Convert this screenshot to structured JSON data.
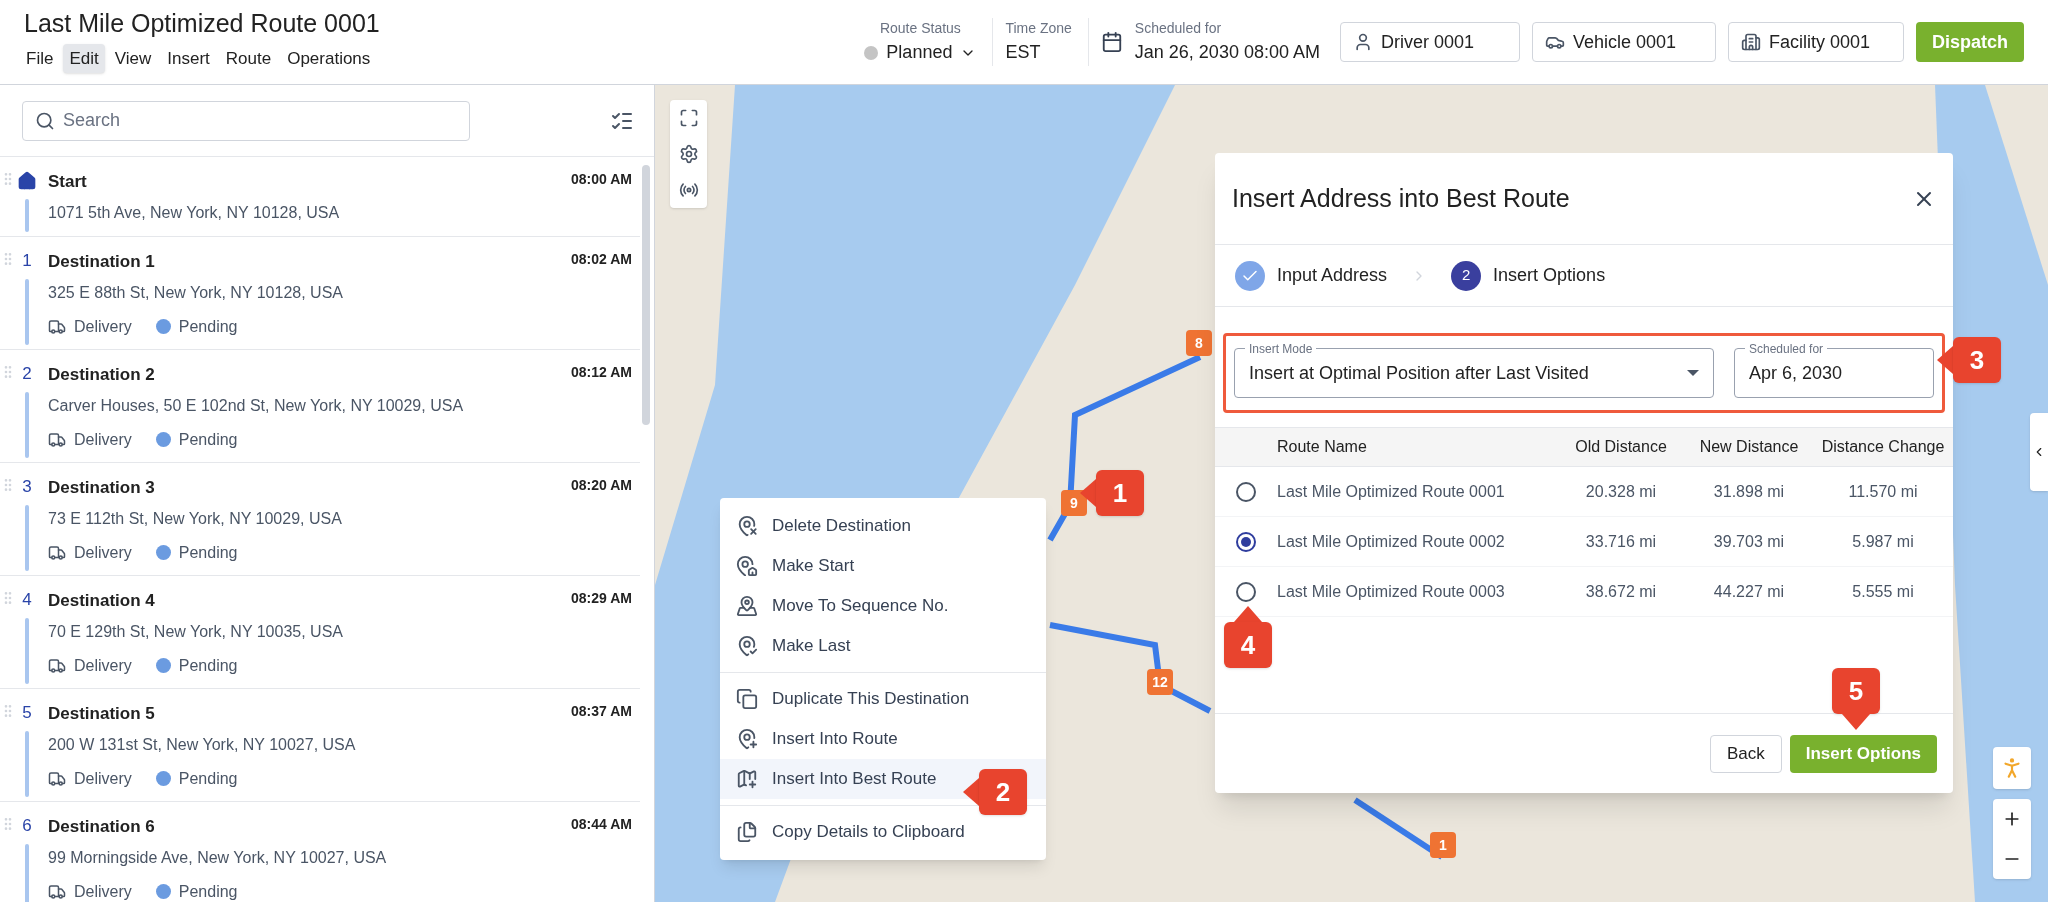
{
  "header": {
    "title": "Last Mile Optimized Route 0001",
    "menu": [
      {
        "label": "File",
        "selected": false
      },
      {
        "label": "Edit",
        "selected": true
      },
      {
        "label": "View",
        "selected": false
      },
      {
        "label": "Insert",
        "selected": false
      },
      {
        "label": "Route",
        "selected": false
      },
      {
        "label": "Operations",
        "selected": false
      }
    ],
    "route_status": {
      "label": "Route Status",
      "value": "Planned",
      "color": "#c4c4c4"
    },
    "time_zone": {
      "label": "Time Zone",
      "value": "EST"
    },
    "scheduled": {
      "label": "Scheduled for",
      "value": "Jan 26, 2030 08:00 AM"
    },
    "driver": "Driver 0001",
    "vehicle": "Vehicle 0001",
    "facility": "Facility 0001",
    "dispatch": "Dispatch"
  },
  "sidebar": {
    "search_placeholder": "Search",
    "stops": [
      {
        "kind": "start",
        "name": "Start",
        "address": "1071 5th Ave, New York, NY 10128, USA",
        "time": "08:00 AM"
      },
      {
        "kind": "destination",
        "number": "1",
        "name": "Destination 1",
        "address": "325 E 88th St, New York, NY 10128, USA",
        "time": "08:02 AM",
        "type": "Delivery",
        "status": "Pending",
        "color": "#6b9be0"
      },
      {
        "kind": "destination",
        "number": "2",
        "name": "Destination 2",
        "address": "Carver Houses, 50 E 102nd St, New York, NY 10029, USA",
        "time": "08:12 AM",
        "type": "Delivery",
        "status": "Pending",
        "color": "#6b9be0"
      },
      {
        "kind": "destination",
        "number": "3",
        "name": "Destination 3",
        "address": "73 E 112th St, New York, NY 10029, USA",
        "time": "08:20 AM",
        "type": "Delivery",
        "status": "Pending",
        "color": "#6b9be0"
      },
      {
        "kind": "destination",
        "number": "4",
        "name": "Destination 4",
        "address": "70 E 129th St, New York, NY 10035, USA",
        "time": "08:29 AM",
        "type": "Delivery",
        "status": "Pending",
        "color": "#6b9be0"
      },
      {
        "kind": "destination",
        "number": "5",
        "name": "Destination 5",
        "address": "200 W 131st St, New York, NY 10027, USA",
        "time": "08:37 AM",
        "type": "Delivery",
        "status": "Pending",
        "color": "#6b9be0"
      },
      {
        "kind": "destination",
        "number": "6",
        "name": "Destination 6",
        "address": "99 Morningside Ave, New York, NY 10027, USA",
        "time": "08:44 AM",
        "type": "Delivery",
        "status": "Pending",
        "color": "#6b9be0"
      }
    ]
  },
  "map": {
    "markers": [
      "8",
      "9",
      "12",
      "1"
    ]
  },
  "context_menu": {
    "groups": [
      [
        {
          "kind": "delete",
          "label": "Delete Destination",
          "selected": false
        },
        {
          "kind": "start",
          "label": "Make Start",
          "selected": false
        },
        {
          "kind": "move",
          "label": "Move To Sequence No.",
          "selected": false
        },
        {
          "kind": "last",
          "label": "Make Last",
          "selected": false
        }
      ],
      [
        {
          "kind": "duplicate",
          "label": "Duplicate This Destination",
          "selected": false
        },
        {
          "kind": "insert",
          "label": "Insert Into Route",
          "selected": false
        },
        {
          "kind": "best",
          "label": "Insert Into Best Route",
          "selected": true
        }
      ],
      [
        {
          "kind": "copy",
          "label": "Copy Details to Clipboard",
          "selected": false
        }
      ]
    ]
  },
  "dialog": {
    "title": "Insert Address into Best Route",
    "steps": [
      {
        "label": "Input Address",
        "done": true
      },
      {
        "number": "2",
        "label": "Insert Options",
        "done": false
      }
    ],
    "insert_mode": {
      "label": "Insert Mode",
      "value": "Insert at Optimal Position after Last Visited"
    },
    "scheduled_for": {
      "label": "Scheduled for",
      "value": "Apr 6, 2030"
    },
    "columns": [
      "Route Name",
      "Old Distance",
      "New Distance",
      "Distance Change"
    ],
    "rows": [
      {
        "selected": false,
        "route_name": "Last Mile Optimized Route 0001",
        "old": "20.328 mi",
        "new": "31.898 mi",
        "change": "11.570 mi"
      },
      {
        "selected": true,
        "route_name": "Last Mile Optimized Route 0002",
        "old": "33.716 mi",
        "new": "39.703 mi",
        "change": "5.987 mi"
      },
      {
        "selected": false,
        "route_name": "Last Mile Optimized Route 0003",
        "old": "38.672 mi",
        "new": "44.227 mi",
        "change": "5.555 mi"
      }
    ],
    "back": "Back",
    "submit": "Insert Options"
  },
  "callouts": [
    {
      "number": "1",
      "kind": "left"
    },
    {
      "number": "2",
      "kind": "left"
    },
    {
      "number": "3",
      "kind": "left"
    },
    {
      "number": "4",
      "kind": "up"
    },
    {
      "number": "5",
      "kind": "down"
    }
  ]
}
